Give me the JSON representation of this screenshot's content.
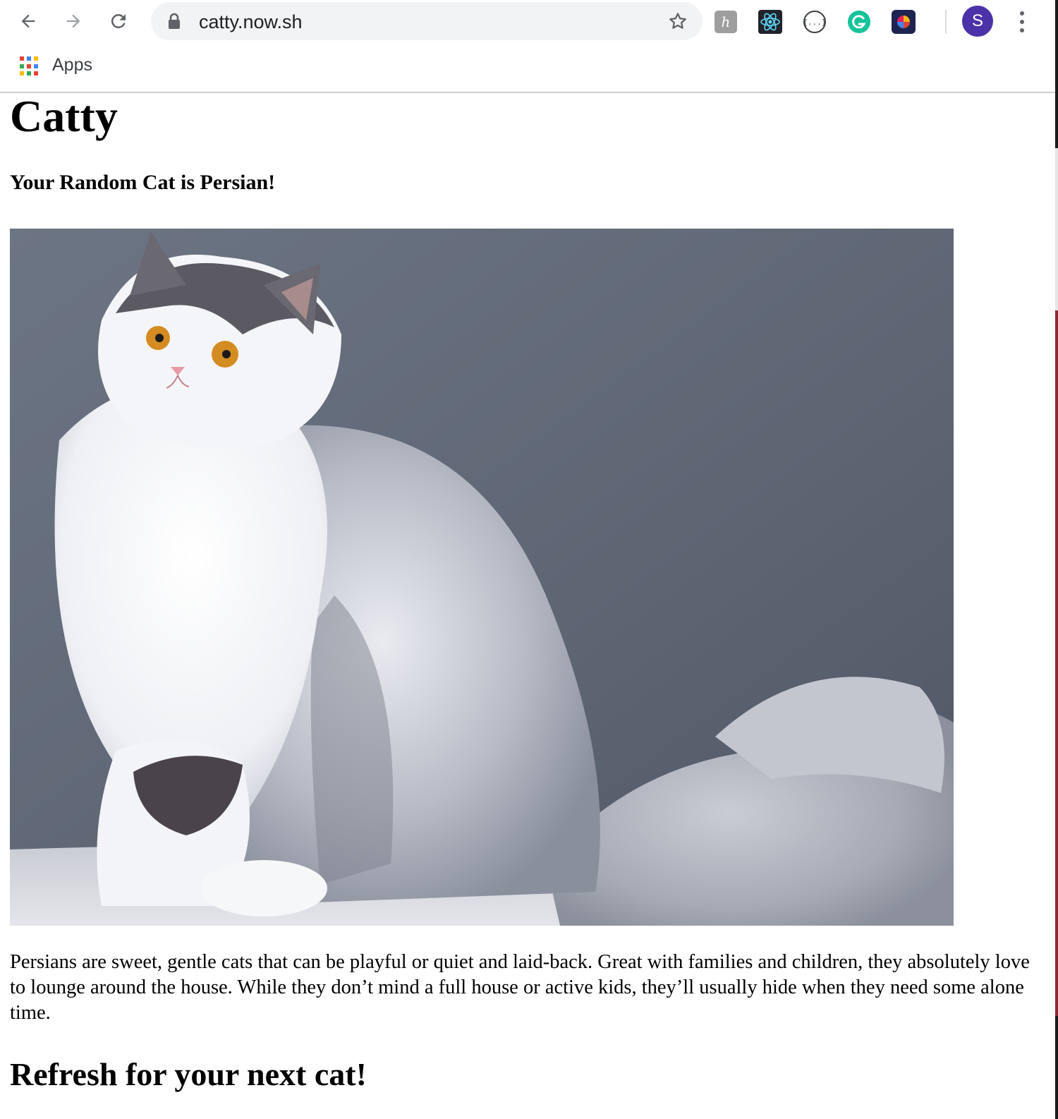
{
  "browser": {
    "url": "catty.now.sh",
    "bookmarks": {
      "apps_label": "Apps"
    },
    "profile_initial": "S",
    "extensions": [
      "honey-icon",
      "react-devtools-icon",
      "json-viewer-icon",
      "grammarly-icon",
      "color-picker-icon"
    ],
    "colors": {
      "avatar": "#4b32a8",
      "omnibox": "#f1f3f4",
      "grammarly": "#15c39a"
    }
  },
  "page": {
    "title": "Catty",
    "subtitle": "Your Random Cat is Persian!",
    "description": "Persians are sweet, gentle cats that can be playful or quiet and laid-back. Great with families and children, they absolutely love to lounge around the house. While they don’t mind a full house or active kids, they’ll usually hide when they need some alone time.",
    "refresh_heading": "Refresh for your next cat!"
  }
}
